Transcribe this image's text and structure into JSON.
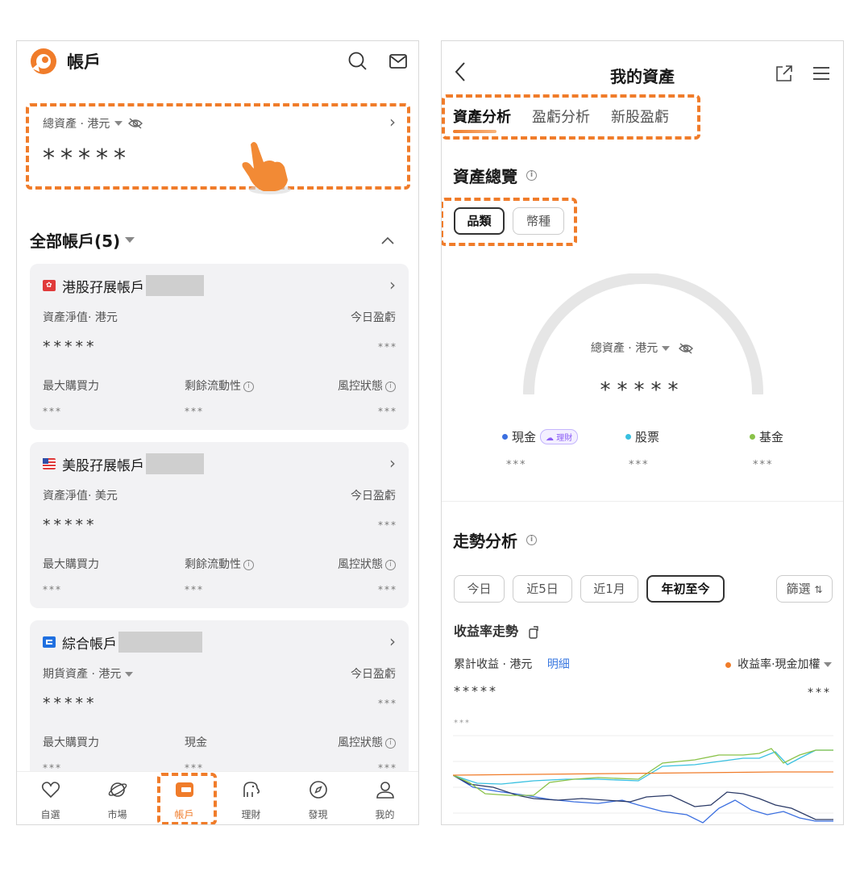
{
  "left": {
    "header": {
      "title": "帳戶",
      "logo_icon": "brand-logo-icon",
      "search_icon": "search-icon",
      "mail_icon": "mail-icon"
    },
    "total": {
      "label": "總資產 · 港元",
      "value": "*****",
      "eye_icon": "eye-off-icon"
    },
    "all_accounts": {
      "title": "全部帳戶(5)"
    },
    "accounts": [
      {
        "name": "港股孖展帳戶",
        "flag": "hk-flag-icon",
        "nav_label": "資產淨值· 港元",
        "pl_label": "今日盈虧",
        "nav_value": "*****",
        "pl_value": "***",
        "metrics": [
          {
            "label": "最大購買力",
            "value": "***",
            "info": false
          },
          {
            "label": "剩餘流動性",
            "value": "***",
            "info": true
          },
          {
            "label": "風控狀態",
            "value": "***",
            "info": true
          }
        ]
      },
      {
        "name": "美股孖展帳戶",
        "flag": "us-flag-icon",
        "nav_label": "資產淨值· 美元",
        "pl_label": "今日盈虧",
        "nav_value": "*****",
        "pl_value": "***",
        "metrics": [
          {
            "label": "最大購買力",
            "value": "***",
            "info": false
          },
          {
            "label": "剩餘流動性",
            "value": "***",
            "info": true
          },
          {
            "label": "風控狀態",
            "value": "***",
            "info": true
          }
        ]
      },
      {
        "name": "綜合帳戶",
        "flag": "universal-account-icon",
        "nav_label": "期貨資產 · 港元",
        "pl_label": "今日盈虧",
        "nav_value": "*****",
        "pl_value": "***",
        "metrics": [
          {
            "label": "最大購買力",
            "value": "***",
            "info": false
          },
          {
            "label": "現金",
            "value": "***",
            "info": false
          },
          {
            "label": "風控狀態",
            "value": "***",
            "info": true
          }
        ]
      }
    ],
    "tabbar": [
      {
        "label": "自選",
        "icon": "heart-icon"
      },
      {
        "label": "市場",
        "icon": "planet-icon"
      },
      {
        "label": "帳戶",
        "icon": "wallet-icon",
        "active": true
      },
      {
        "label": "理財",
        "icon": "elephant-icon"
      },
      {
        "label": "發現",
        "icon": "compass-icon"
      },
      {
        "label": "我的",
        "icon": "person-icon"
      }
    ]
  },
  "right": {
    "header": {
      "title": "我的資產",
      "back_icon": "back-arrow-icon",
      "share_icon": "share-icon",
      "menu_icon": "menu-icon"
    },
    "tabs": [
      "資產分析",
      "盈虧分析",
      "新股盈虧"
    ],
    "overview": {
      "title": "資產總覽",
      "pills": [
        "品類",
        "幣種"
      ]
    },
    "gauge": {
      "label": "總資產 · 港元",
      "value": "*****"
    },
    "legend": [
      {
        "label": "現金",
        "color": "#3b6fe0",
        "tag": "理財",
        "value": "***"
      },
      {
        "label": "股票",
        "color": "#38c0e0",
        "value": "***"
      },
      {
        "label": "基金",
        "color": "#8ac249",
        "value": "***"
      }
    ],
    "trend": {
      "title": "走勢分析",
      "periods": [
        "今日",
        "近5日",
        "近1月",
        "年初至今"
      ],
      "filter": "篩選",
      "returns_title": "收益率走勢",
      "cum_label": "累計收益 · 港元",
      "detail_link": "明細",
      "metric_label": "收益率·現金加權",
      "cum_value": "*****",
      "rate_value": "***",
      "axis_value": "***"
    },
    "colors": {
      "accent": "#f07c2a",
      "green": "#8ac249",
      "cyan": "#38c0e0",
      "navy": "#2b3a67",
      "blue": "#3b6fe0"
    }
  }
}
